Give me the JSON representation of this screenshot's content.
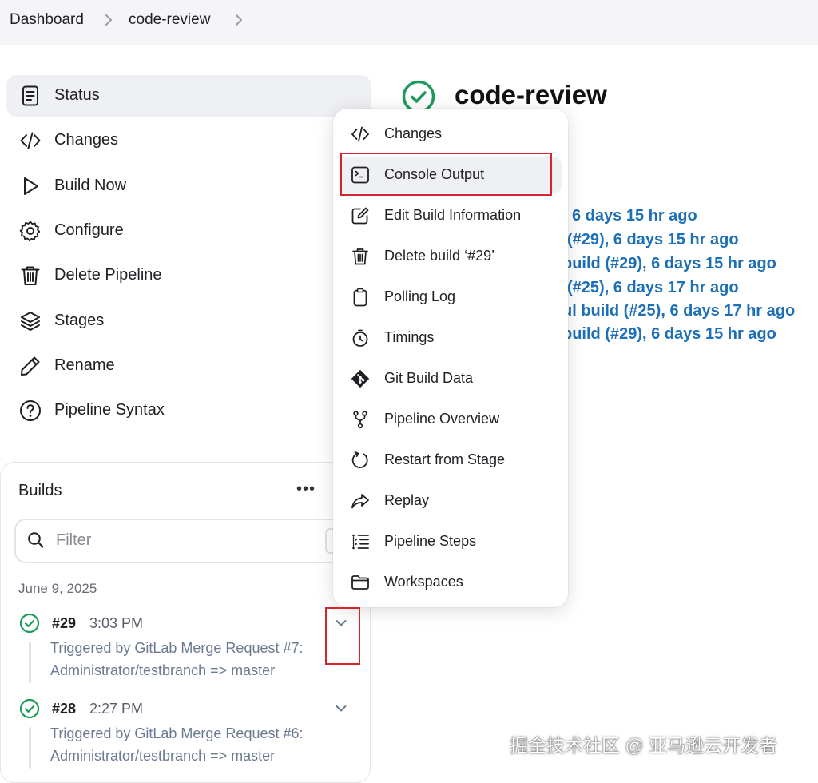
{
  "breadcrumb": {
    "items": [
      "Dashboard",
      "code-review"
    ]
  },
  "sidebar": {
    "items": [
      {
        "label": "Status",
        "icon": "document-icon",
        "active": true
      },
      {
        "label": "Changes",
        "icon": "code-icon"
      },
      {
        "label": "Build Now",
        "icon": "play-icon"
      },
      {
        "label": "Configure",
        "icon": "gear-icon"
      },
      {
        "label": "Delete Pipeline",
        "icon": "trash-icon"
      },
      {
        "label": "Stages",
        "icon": "layers-icon"
      },
      {
        "label": "Rename",
        "icon": "pencil-icon"
      },
      {
        "label": "Pipeline Syntax",
        "icon": "help-icon"
      }
    ]
  },
  "main": {
    "title": "code-review",
    "title_icon": "success-check-icon",
    "permalinks": [
      "6 days 15 hr ago",
      "(#29), 6 days 15 hr ago",
      "build (#29), 6 days 15 hr ago",
      "(#25), 6 days 17 hr ago",
      "ul build (#25), 6 days 17 hr ago",
      "build (#29), 6 days 15 hr ago"
    ]
  },
  "builds": {
    "title": "Builds",
    "more": "•••",
    "filter_placeholder": "Filter",
    "date": "June 9, 2025",
    "items": [
      {
        "number": "#29",
        "time": "3:03 PM",
        "desc1": "Triggered by GitLab Merge Request #7:",
        "desc2": "Administrator/testbranch => master"
      },
      {
        "number": "#28",
        "time": "2:27 PM",
        "desc1": "Triggered by GitLab Merge Request #6:",
        "desc2": "Administrator/testbranch => master"
      }
    ]
  },
  "context_menu": {
    "items": [
      {
        "label": "Changes",
        "icon": "code-icon"
      },
      {
        "label": "Console Output",
        "icon": "terminal-icon",
        "highlighted": true
      },
      {
        "label": "Edit Build Information",
        "icon": "edit-icon"
      },
      {
        "label": "Delete build ‘#29’",
        "icon": "trash-icon"
      },
      {
        "label": "Polling Log",
        "icon": "clipboard-icon"
      },
      {
        "label": "Timings",
        "icon": "stopwatch-icon"
      },
      {
        "label": "Git Build Data",
        "icon": "git-icon"
      },
      {
        "label": "Pipeline Overview",
        "icon": "branch-icon"
      },
      {
        "label": "Restart from Stage",
        "icon": "restart-icon"
      },
      {
        "label": "Replay",
        "icon": "replay-icon"
      },
      {
        "label": "Pipeline Steps",
        "icon": "list-icon"
      },
      {
        "label": "Workspaces",
        "icon": "folder-icon"
      }
    ]
  },
  "colors": {
    "accent_link": "#1d6fb8",
    "success": "#1a9b5b",
    "annotation": "#d9232e"
  },
  "watermark": "掘金技术社区 @ 亚马逊云开发者"
}
